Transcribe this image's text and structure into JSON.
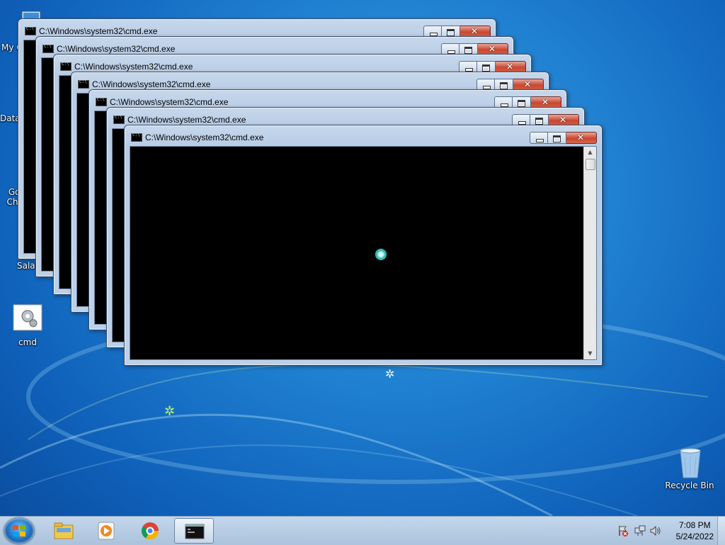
{
  "desktop": {
    "icons": [
      {
        "label": "My Comp",
        "name": "my-computer"
      },
      {
        "label": "DataWag",
        "name": "datawag"
      },
      {
        "label": "Google Chrome",
        "name": "google-chrome"
      },
      {
        "label": "Salad",
        "name": "salad"
      },
      {
        "label": "cmd",
        "name": "cmd"
      },
      {
        "label": "Recycle Bin",
        "name": "recycle-bin"
      }
    ]
  },
  "windows": [
    {
      "title": "C:\\Windows\\system32\\cmd.exe"
    },
    {
      "title": "C:\\Windows\\system32\\cmd.exe"
    },
    {
      "title": "C:\\Windows\\system32\\cmd.exe"
    },
    {
      "title": "C:\\Windows\\system32\\cmd.exe"
    },
    {
      "title": "C:\\Windows\\system32\\cmd.exe"
    },
    {
      "title": "C:\\Windows\\system32\\cmd.exe"
    },
    {
      "title": "C:\\Windows\\system32\\cmd.exe"
    }
  ],
  "taskbar": {
    "pinned": [
      "windows-explorer-icon",
      "media-player-icon",
      "chrome-icon",
      "cmd-icon"
    ],
    "clock": {
      "time": "7:08 PM",
      "date": "5/24/2022"
    }
  }
}
